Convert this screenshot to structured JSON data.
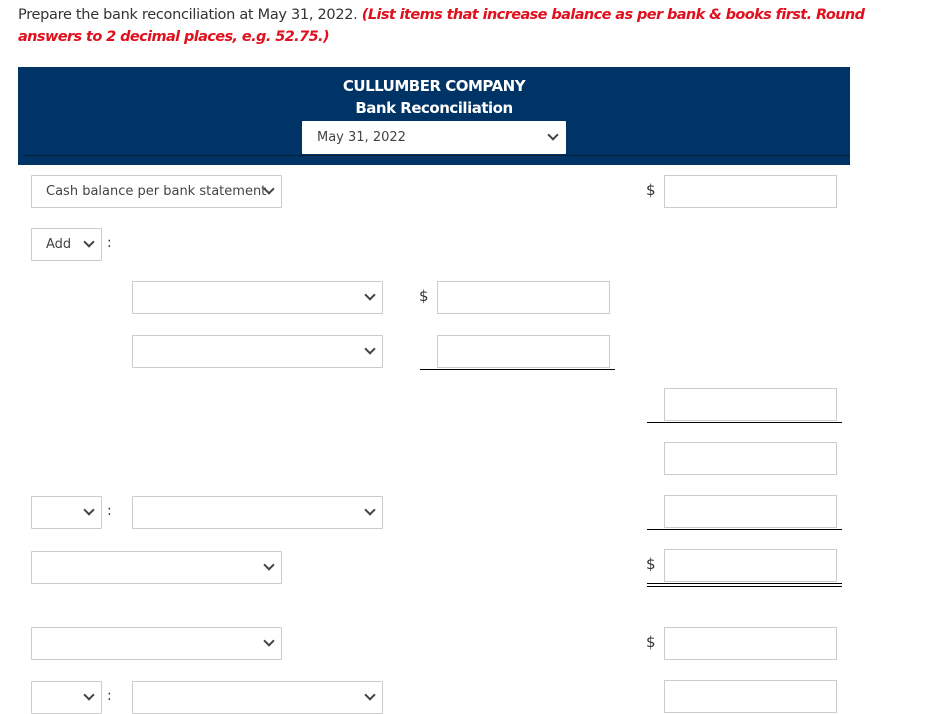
{
  "instructions": {
    "text": "Prepare the bank reconciliation at May 31, 2022.",
    "note": "(List items that increase balance as per bank & books first. Round answers to 2 decimal places, e.g. 52.75.)"
  },
  "header": {
    "company": "CULLUMBER COMPANY",
    "title": "Bank Reconciliation",
    "date_selected": "May 31, 2022",
    "background_color": "#003366"
  },
  "rows": {
    "bank_balance_label": "Cash balance per bank statement",
    "add_label": "Add",
    "colon": ":",
    "currency_symbol": "$",
    "empty": ""
  },
  "colors": {
    "note_color": "#e0101e",
    "header_navy": "#003366"
  }
}
